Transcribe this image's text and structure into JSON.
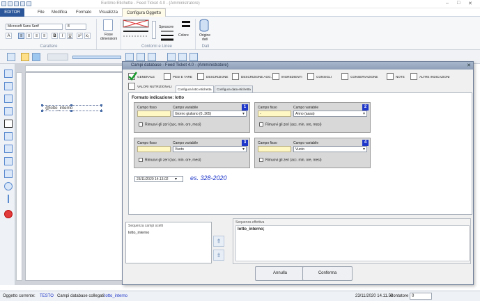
{
  "titlebar": {
    "title": "Euritmo Etichette - Feed Ticket 4.0 - (Amministratore)",
    "min": "–",
    "max": "□",
    "close": "✕"
  },
  "menu": {
    "editor": "EDITOR",
    "file": "File",
    "modifica": "Modifica",
    "formato": "Formato",
    "visualizza": "Visualizza",
    "configura": "Configura Oggetto"
  },
  "ribbon": {
    "font_name": "Microsoft Sans Serif",
    "font_size": "8",
    "bold": "B",
    "italic": "I",
    "underline": "U",
    "group_carattere": "Carattere",
    "fisse_dimensioni": "Fisse dimensioni",
    "group_contorni": "Contorni e Linee",
    "spessore": "Spessore",
    "colore": "Colore",
    "origine_dati": "Origine dati",
    "group_dati": "Dati"
  },
  "canvas": {
    "object_label": "@lotto_interno"
  },
  "dialog": {
    "title": "Campi database - Feed Ticket 4.0 - (Amministratore)",
    "close": "✕",
    "checks": [
      {
        "label": "GENERALE",
        "checked": true
      },
      {
        "label": "PESI E TARE",
        "checked": false
      },
      {
        "label": "DESCRIZIONE",
        "checked": false
      },
      {
        "label": "DESCRIZIONE AGG.",
        "checked": false
      },
      {
        "label": "INGREDIENTI",
        "checked": false
      },
      {
        "label": "CONSIGLI",
        "checked": false
      },
      {
        "label": "CONSERVAZIONE",
        "checked": false
      },
      {
        "label": "NOTE",
        "checked": false
      },
      {
        "label": "ALTRE INDICAZIONI",
        "checked": false
      },
      {
        "label": "VALORI NUTRIZIONALI",
        "checked": false
      }
    ],
    "tabs": [
      "Configura lotto etichetta",
      "Configura data etichetta"
    ],
    "panel_title": "Formato indicazione: lotto",
    "col_fisso": "Campo fisso",
    "col_variabile": "Campo variabile",
    "remove_label": "Rimuovi gli zeri (acc. min. ore, mesi)",
    "blocks": [
      {
        "num": "1",
        "fisso": "",
        "variabile": "Giorno giuliano (0..365)"
      },
      {
        "num": "2",
        "fisso": "-",
        "variabile": "Anno (aaaa)"
      },
      {
        "num": "3",
        "fisso": "",
        "variabile": "Vuoto"
      },
      {
        "num": "4",
        "fisso": "",
        "variabile": "Vuoto"
      }
    ],
    "date_value": "23/11/2020 14.13.02",
    "example": "es. 328-2020",
    "seq_left_header": "Sequenza campi scelti",
    "seq_left_value": "lotto_interno",
    "seq_right_header": "Sequenza effettiva",
    "seq_right_value": "lotto_interno;",
    "btn_annulla": "Annulla",
    "btn_conferma": "Conferma"
  },
  "status": {
    "oggetto_label": "Oggetto corrente:",
    "oggetto_value": "TESTO",
    "campi_label": "Campi database collegati:",
    "campi_value": "lotto_interno",
    "datetime": "23/11/2020 14.11.54",
    "contatore_label": "Contatore",
    "contatore_value": "0"
  },
  "colors": {
    "accent": "#2b579a",
    "number_badge": "#1f37c9",
    "fixed_field": "#fff7c4"
  }
}
